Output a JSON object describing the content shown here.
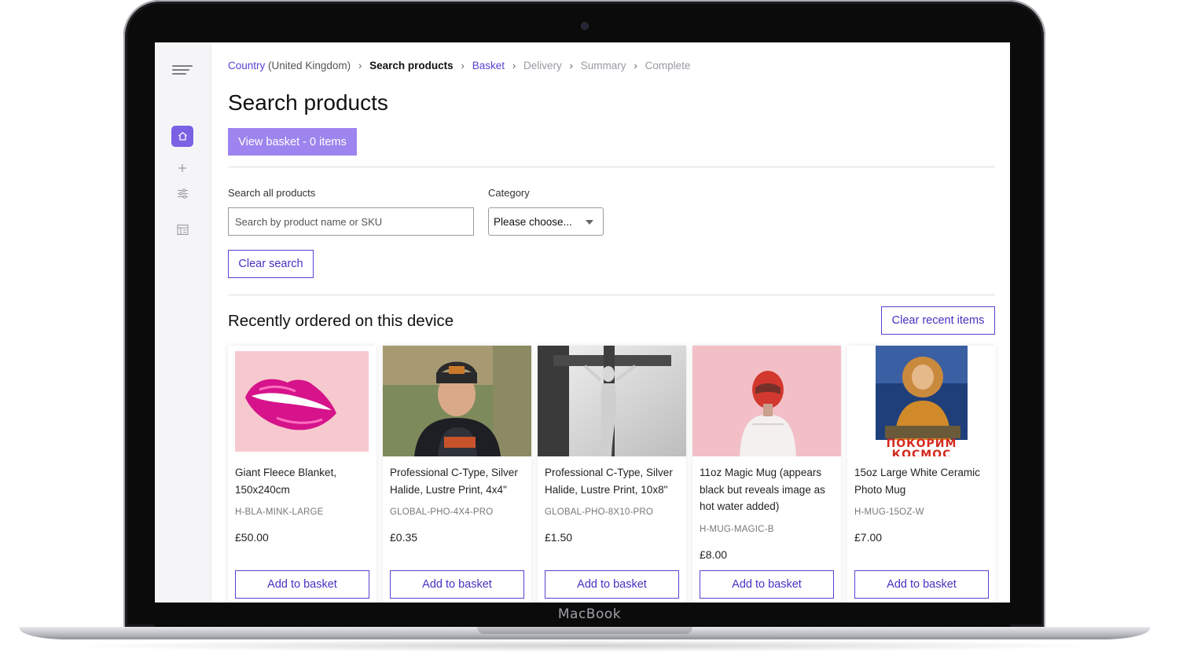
{
  "device": {
    "brand": "MacBook"
  },
  "breadcrumb": {
    "country_label": "Country",
    "country_value": "(United Kingdom)",
    "search": "Search products",
    "basket": "Basket",
    "delivery": "Delivery",
    "summary": "Summary",
    "complete": "Complete",
    "separator": "›"
  },
  "page": {
    "title": "Search products",
    "view_basket": "View basket - 0 items"
  },
  "search": {
    "label": "Search all products",
    "placeholder": "Search by product name or SKU",
    "value": "",
    "category_label": "Category",
    "category_value": "Please choose...",
    "clear_label": "Clear search"
  },
  "recent": {
    "heading": "Recently ordered on this device",
    "clear_label": "Clear recent items"
  },
  "products": [
    {
      "title": "Giant Fleece Blanket, 150x240cm",
      "sku": "H-BLA-MINK-LARGE",
      "price": "£50.00",
      "button": "Add to basket",
      "image": "lips-illustration"
    },
    {
      "title": "Professional C-Type, Silver Halide, Lustre Print, 4x4\"",
      "sku": "GLOBAL-PHO-4X4-PRO",
      "price": "£0.35",
      "button": "Add to basket",
      "image": "boy-portrait-photo"
    },
    {
      "title": "Professional C-Type, Silver Halide, Lustre Print, 10x8\"",
      "sku": "GLOBAL-PHO-8X10-PRO",
      "price": "£1.50",
      "button": "Add to basket",
      "image": "black-white-cross-photo"
    },
    {
      "title": "11oz Magic Mug (appears black but reveals image as hot water added)",
      "sku": "H-MUG-MAGIC-B",
      "price": "£8.00",
      "button": "Add to basket",
      "image": "helmet-figure-pink"
    },
    {
      "title": "15oz Large White Ceramic Photo Mug",
      "sku": "H-MUG-15OZ-W",
      "price": "£7.00",
      "button": "Add to basket",
      "image": "soviet-cosmonaut-poster"
    }
  ],
  "colors": {
    "accent": "#5b3fd1",
    "primary_button": "#9d84ee",
    "sidebar_active": "#7b61e4",
    "poster_text": "#d42a1e"
  },
  "icons": [
    "menu-icon",
    "home-icon",
    "plus-icon",
    "sliders-icon",
    "calendar-icon",
    "chevron-down-icon"
  ]
}
